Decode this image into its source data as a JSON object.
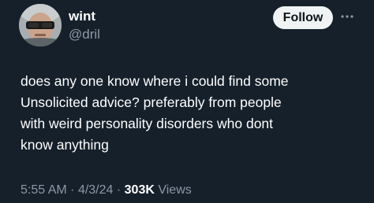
{
  "author": {
    "display_name": "wint",
    "handle": "@dril"
  },
  "actions": {
    "follow_label": "Follow",
    "more_icon": "more-horizontal-icon"
  },
  "tweet": {
    "text_lines": [
      "does any one know where i could find some",
      "Unsolicited advice? preferably from people",
      "with weird personality disorders who dont",
      "know anything"
    ]
  },
  "meta": {
    "time": "5:55 AM",
    "separator": "·",
    "date": "4/3/24",
    "views_count": "303K",
    "views_label": "Views"
  },
  "colors": {
    "background": "#15202b",
    "text_primary": "#ffffff",
    "text_secondary": "#8b98a5",
    "follow_bg": "#eff3f4",
    "follow_text": "#0f1419"
  }
}
